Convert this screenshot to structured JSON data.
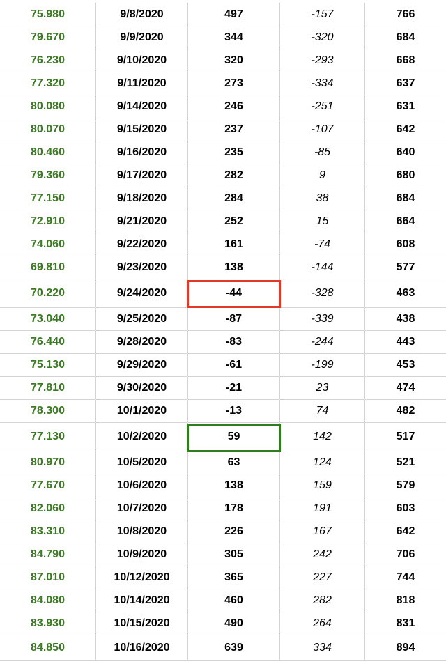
{
  "colors": {
    "first_column_text": "#3c7a23",
    "highlight_red": "#e2392b",
    "highlight_green": "#2f7d1e",
    "gridline": "#d4d4d4"
  },
  "rows": [
    {
      "c0": "75.980",
      "c1": "9/8/2020",
      "c2": "497",
      "c3": "-157",
      "c4": "766"
    },
    {
      "c0": "79.670",
      "c1": "9/9/2020",
      "c2": "344",
      "c3": "-320",
      "c4": "684"
    },
    {
      "c0": "76.230",
      "c1": "9/10/2020",
      "c2": "320",
      "c3": "-293",
      "c4": "668"
    },
    {
      "c0": "77.320",
      "c1": "9/11/2020",
      "c2": "273",
      "c3": "-334",
      "c4": "637"
    },
    {
      "c0": "80.080",
      "c1": "9/14/2020",
      "c2": "246",
      "c3": "-251",
      "c4": "631"
    },
    {
      "c0": "80.070",
      "c1": "9/15/2020",
      "c2": "237",
      "c3": "-107",
      "c4": "642"
    },
    {
      "c0": "80.460",
      "c1": "9/16/2020",
      "c2": "235",
      "c3": "-85",
      "c4": "640"
    },
    {
      "c0": "79.360",
      "c1": "9/17/2020",
      "c2": "282",
      "c3": "9",
      "c4": "680"
    },
    {
      "c0": "77.150",
      "c1": "9/18/2020",
      "c2": "284",
      "c3": "38",
      "c4": "684"
    },
    {
      "c0": "72.910",
      "c1": "9/21/2020",
      "c2": "252",
      "c3": "15",
      "c4": "664"
    },
    {
      "c0": "74.060",
      "c1": "9/22/2020",
      "c2": "161",
      "c3": "-74",
      "c4": "608"
    },
    {
      "c0": "69.810",
      "c1": "9/23/2020",
      "c2": "138",
      "c3": "-144",
      "c4": "577"
    },
    {
      "c0": "70.220",
      "c1": "9/24/2020",
      "c2": "-44",
      "c3": "-328",
      "c4": "463"
    },
    {
      "c0": "73.040",
      "c1": "9/25/2020",
      "c2": "-87",
      "c3": "-339",
      "c4": "438"
    },
    {
      "c0": "76.440",
      "c1": "9/28/2020",
      "c2": "-83",
      "c3": "-244",
      "c4": "443"
    },
    {
      "c0": "75.130",
      "c1": "9/29/2020",
      "c2": "-61",
      "c3": "-199",
      "c4": "453"
    },
    {
      "c0": "77.810",
      "c1": "9/30/2020",
      "c2": "-21",
      "c3": "23",
      "c4": "474"
    },
    {
      "c0": "78.300",
      "c1": "10/1/2020",
      "c2": "-13",
      "c3": "74",
      "c4": "482"
    },
    {
      "c0": "77.130",
      "c1": "10/2/2020",
      "c2": "59",
      "c3": "142",
      "c4": "517"
    },
    {
      "c0": "80.970",
      "c1": "10/5/2020",
      "c2": "63",
      "c3": "124",
      "c4": "521"
    },
    {
      "c0": "77.670",
      "c1": "10/6/2020",
      "c2": "138",
      "c3": "159",
      "c4": "579"
    },
    {
      "c0": "82.060",
      "c1": "10/7/2020",
      "c2": "178",
      "c3": "191",
      "c4": "603"
    },
    {
      "c0": "83.310",
      "c1": "10/8/2020",
      "c2": "226",
      "c3": "167",
      "c4": "642"
    },
    {
      "c0": "84.790",
      "c1": "10/9/2020",
      "c2": "305",
      "c3": "242",
      "c4": "706"
    },
    {
      "c0": "87.010",
      "c1": "10/12/2020",
      "c2": "365",
      "c3": "227",
      "c4": "744"
    },
    {
      "c0": "84.080",
      "c1": "10/14/2020",
      "c2": "460",
      "c3": "282",
      "c4": "818"
    },
    {
      "c0": "83.930",
      "c1": "10/15/2020",
      "c2": "490",
      "c3": "264",
      "c4": "831"
    },
    {
      "c0": "84.850",
      "c1": "10/16/2020",
      "c2": "639",
      "c3": "334",
      "c4": "894"
    }
  ]
}
